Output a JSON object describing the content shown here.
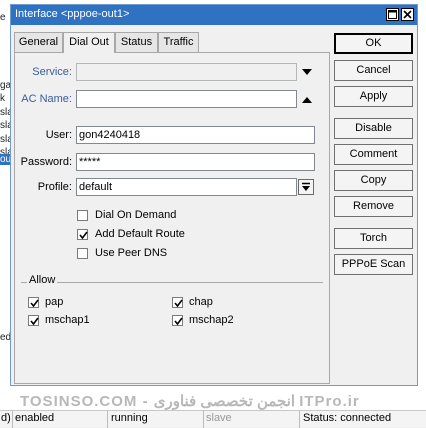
{
  "window": {
    "title": "Interface <pppoe-out1>"
  },
  "tabs": [
    "General",
    "Dial Out",
    "Status",
    "Traffic"
  ],
  "form": {
    "service_label": "Service:",
    "service_value": "",
    "ac_name_label": "AC Name:",
    "ac_name_value": "",
    "user_label": "User:",
    "user_value": "gon4240418",
    "password_label": "Password:",
    "password_value": "*****",
    "profile_label": "Profile:",
    "profile_value": "default"
  },
  "options": [
    {
      "label": "Dial On Demand",
      "checked": false
    },
    {
      "label": "Add Default Route",
      "checked": true
    },
    {
      "label": "Use Peer DNS",
      "checked": false
    }
  ],
  "allow": {
    "title": "Allow",
    "items": [
      {
        "label": "pap",
        "checked": true
      },
      {
        "label": "chap",
        "checked": true
      },
      {
        "label": "mschap1",
        "checked": true
      },
      {
        "label": "mschap2",
        "checked": true
      }
    ]
  },
  "buttons": [
    "OK",
    "Cancel",
    "Apply",
    "Disable",
    "Comment",
    "Copy",
    "Remove",
    "Torch",
    "PPPoE Scan"
  ],
  "statusbar": {
    "cells": [
      "d)",
      "enabled",
      "running",
      "slave",
      "Status: connected"
    ]
  },
  "background_rows": [
    "e",
    "ga",
    "k",
    "sla",
    "sla",
    "sla",
    "sla",
    "ou",
    "ed"
  ],
  "watermark": "TOSINSO.COM - انجمن تخصصی فناوری ITPro.ir",
  "colors": {
    "titlebar": "#2f72c2",
    "label_blue": "#3a5d9c"
  }
}
